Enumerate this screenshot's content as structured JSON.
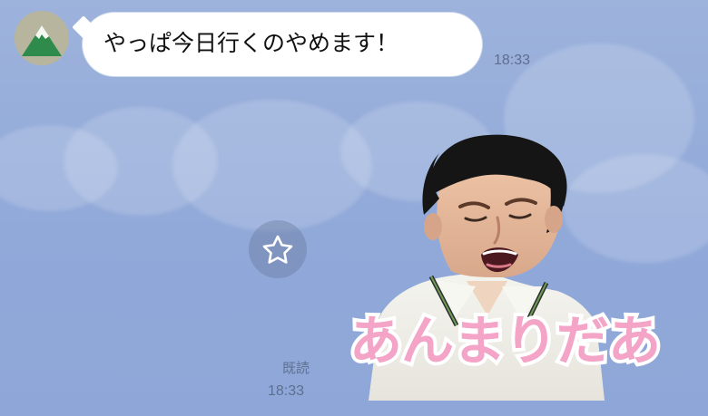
{
  "chat": {
    "incoming_message": {
      "text": "やっぱ今日行くのやめます！",
      "time": "18:33"
    },
    "outgoing_sticker": {
      "caption": "あんまりだあ",
      "read_label": "既読",
      "time": "18:33"
    }
  },
  "ui": {
    "avatar_icon": "mountain-avatar-icon",
    "favorite_icon": "star-icon"
  },
  "colors": {
    "background": "#91a9d9",
    "bubble": "#ffffff",
    "meta_text": "#5d6f8f",
    "sticker_pink": "#f3a4c7"
  }
}
